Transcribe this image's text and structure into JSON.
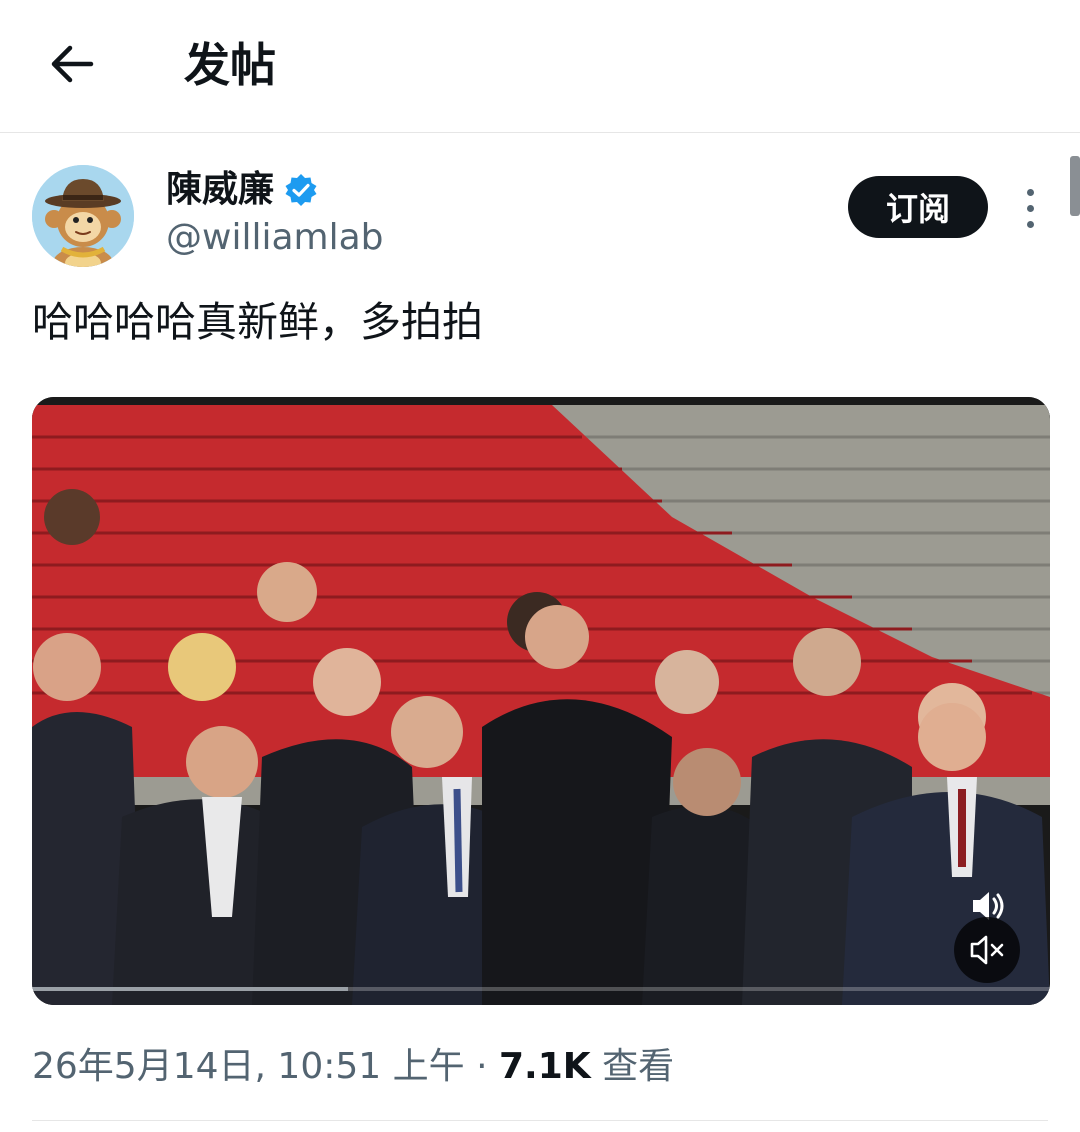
{
  "header": {
    "title": "发帖"
  },
  "author": {
    "display_name": "陳威廉",
    "handle": "@williamlab",
    "verified": true,
    "avatar_icon": "cartoon-monkey-cowboy-hat-avatar"
  },
  "actions": {
    "subscribe_label": "订阅",
    "more_icon": "more-vertical-icon"
  },
  "tweet": {
    "text": "哈哈哈哈真新鲜，多拍拍"
  },
  "media": {
    "type": "video",
    "progress": 0.31,
    "volume_icon": "volume-icon",
    "mute_icon": "volume-mute-icon"
  },
  "meta": {
    "timestamp": "26年5月14日, 10:51 上午",
    "separator": "·",
    "views_count": "7.1K",
    "views_label": "查看"
  },
  "colors": {
    "accent": "#1d9bf0",
    "text_primary": "#0f1419",
    "text_secondary": "#536471",
    "button_bg": "#0f1419"
  }
}
